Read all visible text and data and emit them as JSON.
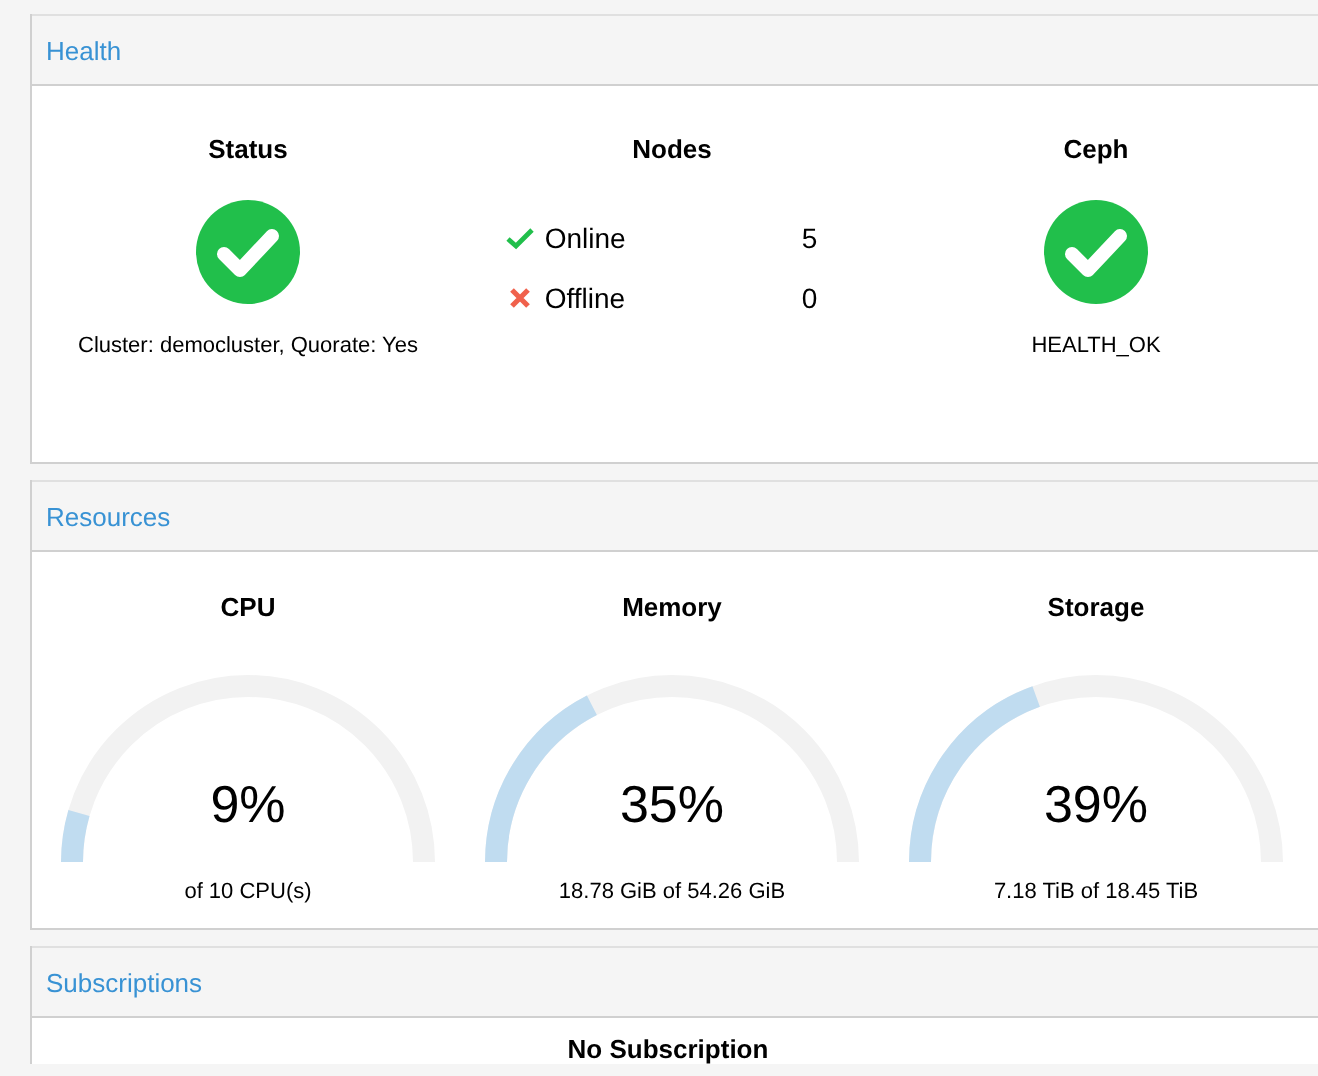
{
  "health": {
    "title": "Health",
    "status": {
      "title": "Status",
      "ok": true,
      "caption": "Cluster: democluster, Quorate: Yes"
    },
    "nodes": {
      "title": "Nodes",
      "rows": [
        {
          "kind": "online",
          "label": "Online",
          "count": "5"
        },
        {
          "kind": "offline",
          "label": "Offline",
          "count": "0"
        }
      ]
    },
    "ceph": {
      "title": "Ceph",
      "ok": true,
      "caption": "HEALTH_OK"
    }
  },
  "resources": {
    "title": "Resources",
    "gauges": [
      {
        "title": "CPU",
        "reading": "9%",
        "caption": "of 10 CPU(s)"
      },
      {
        "title": "Memory",
        "reading": "35%",
        "caption": "18.78 GiB of 54.26 GiB"
      },
      {
        "title": "Storage",
        "reading": "39%",
        "caption": "7.18 TiB of 18.45 TiB"
      }
    ]
  },
  "subscriptions": {
    "title": "Subscriptions",
    "message": "No Subscription"
  }
}
